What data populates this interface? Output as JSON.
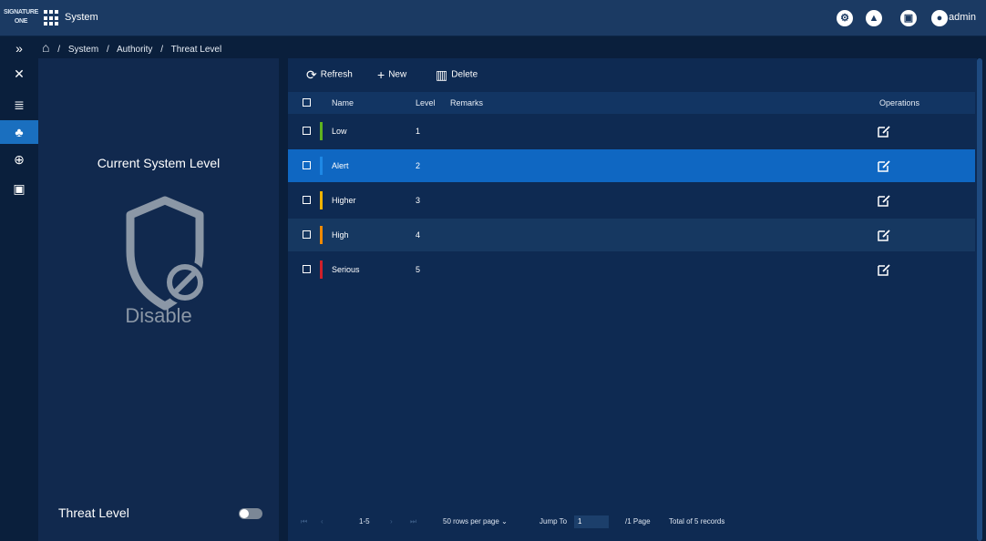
{
  "header": {
    "logo_lines": [
      "SIGNATURE",
      "ONE"
    ],
    "app_title": "System",
    "icons": [
      "lock-icon",
      "bell-icon",
      "alarm-icon",
      "user-icon"
    ],
    "user_name": "admin"
  },
  "leftnav": {
    "items": [
      {
        "icon": "expand-icon",
        "glyph": "»"
      },
      {
        "icon": "tools-icon",
        "glyph": "✕"
      },
      {
        "icon": "database-icon",
        "glyph": "≣"
      },
      {
        "icon": "user-management-icon",
        "glyph": "♣",
        "active": true
      },
      {
        "icon": "globe-icon",
        "glyph": "⊕"
      },
      {
        "icon": "export-icon",
        "glyph": "▣"
      }
    ]
  },
  "breadcrumb": {
    "home_glyph": "⌂",
    "separator": "/",
    "items": [
      "System",
      "Authority",
      "Threat Level"
    ]
  },
  "level_panel": {
    "title": "Current System Level",
    "state": "Disable",
    "threat_label": "Threat Level",
    "toggle_on": false
  },
  "toolbar": {
    "refresh_label": "Refresh",
    "new_label": "New",
    "delete_label": "Delete"
  },
  "table": {
    "columns": [
      "Name",
      "Level",
      "Remarks",
      "Operations"
    ],
    "rows": [
      {
        "name": "Low",
        "level": "1",
        "remarks": "",
        "color": "#5fb31f"
      },
      {
        "name": "Alert",
        "level": "2",
        "remarks": "",
        "color": "#1e88e5",
        "selected": true
      },
      {
        "name": "Higher",
        "level": "3",
        "remarks": "",
        "color": "#f0b400"
      },
      {
        "name": "High",
        "level": "4",
        "remarks": "",
        "color": "#f08a00"
      },
      {
        "name": "Serious",
        "level": "5",
        "remarks": "",
        "color": "#d0202a"
      }
    ]
  },
  "pagination": {
    "range": "1-5",
    "rows_per_page": "50 rows per page",
    "jump_label": "Jump To",
    "jump_value": "1",
    "page_count": "/1 Page",
    "total": "Total of 5 records"
  },
  "colors": {
    "accent": "#1a6fbf",
    "selected_row": "#0f67c2",
    "panel_bg": "#11294e",
    "main_bg": "#0e2a52"
  }
}
